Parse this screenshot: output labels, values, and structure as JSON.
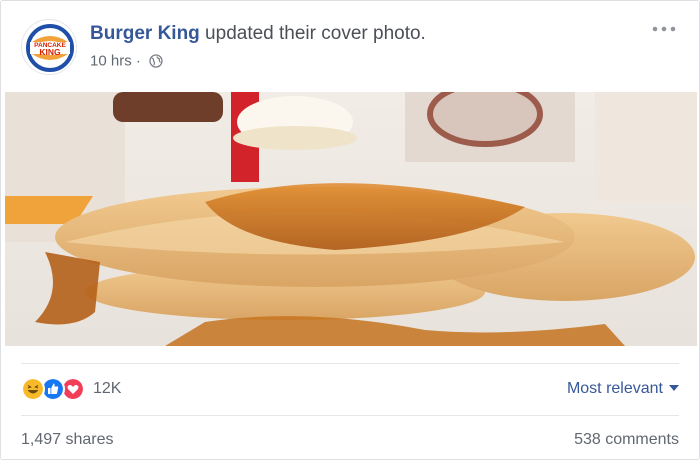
{
  "post": {
    "page_name": "Burger King",
    "action_text": " updated their cover photo.",
    "time": "10 hrs",
    "separator": " · ",
    "privacy_icon": "globe-icon",
    "more_icon": "ellipsis-icon",
    "avatar_text_top": "PANCAKE",
    "avatar_text_bottom": "KING"
  },
  "reactions": {
    "icons": [
      "haha-icon",
      "like-icon",
      "love-icon"
    ],
    "count": "12K",
    "sort_label": "Most relevant"
  },
  "footer": {
    "shares": "1,497 shares",
    "comments": "538 comments"
  },
  "colors": {
    "brand_link": "#365899",
    "muted_text": "#616770",
    "like_blue": "#1877f2",
    "love_red": "#f33e58",
    "haha_yellow": "#f7b928"
  }
}
